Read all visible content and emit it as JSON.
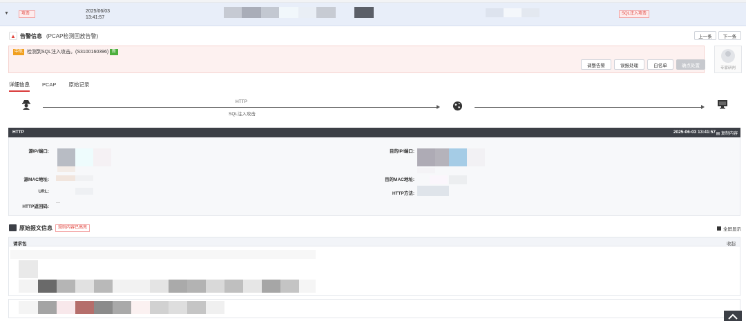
{
  "alert_row": {
    "type_tag": "攻击",
    "date": "2025/06/03",
    "time": "13:41:57",
    "attack_tag": "SQL注入攻击"
  },
  "detail": {
    "title": "告警信息",
    "subtitle": "(PCAP检测回放告警)",
    "prev_label": "上一条",
    "next_label": "下一条"
  },
  "alert": {
    "severity": "中危",
    "message": "检测到SQL注入攻击。(S3100160396)",
    "new_badge": "新",
    "actions": [
      "调整告警",
      "误报处理",
      "白名单",
      "确点处置"
    ],
    "expert_label": "专家研判"
  },
  "tabs": [
    "详细信息",
    "PCAP",
    "原始记录"
  ],
  "flow": {
    "protocol": "HTTP",
    "attack_name": "SQL注入攻击",
    "icons": [
      "hacker-icon",
      "globe-icon",
      "monitor-icon"
    ]
  },
  "http_panel": {
    "title": "HTTP",
    "timestamp": "2025-06-03 13:41:57",
    "copy_label": "复制内容",
    "fields": {
      "src_ip": "源IP/端口:",
      "dst_ip": "目的IP/端口:",
      "src_mac": "源MAC地址:",
      "dst_mac": "目的MAC地址:",
      "url": "URL:",
      "http_method": "HTTP方法:",
      "http_status": "HTTP返回码:",
      "status_value": "---"
    }
  },
  "raw": {
    "title": "原始报文信息",
    "highlight_tag": "规则内容已高亮",
    "fullscreen_label": "全屏显示",
    "request_label": "请求包",
    "collapse_label": "收起"
  },
  "colors": {
    "accent_red": "#e0433b",
    "dark_bar": "#3c3f46",
    "row_highlight": "#e8eef9",
    "severity_orange": "#f0a020",
    "new_green": "#4caf3d"
  }
}
